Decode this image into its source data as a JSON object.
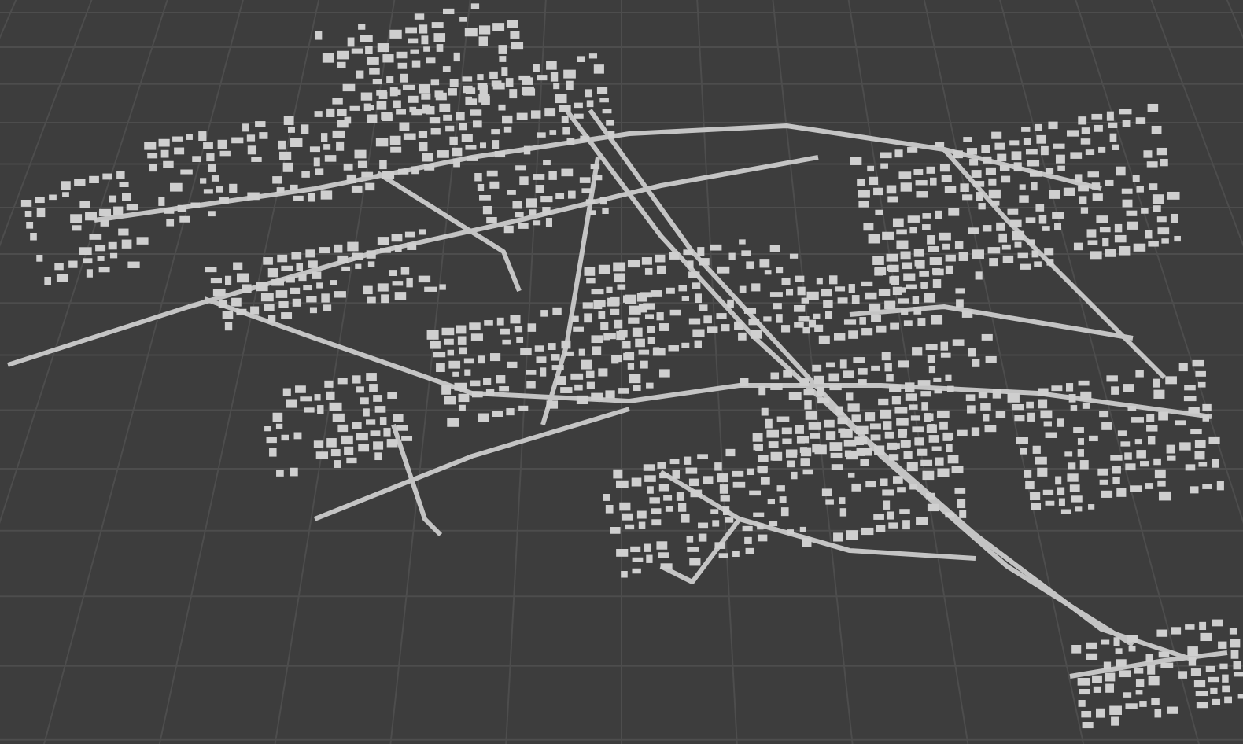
{
  "viewport": {
    "grid_visible": true
  }
}
